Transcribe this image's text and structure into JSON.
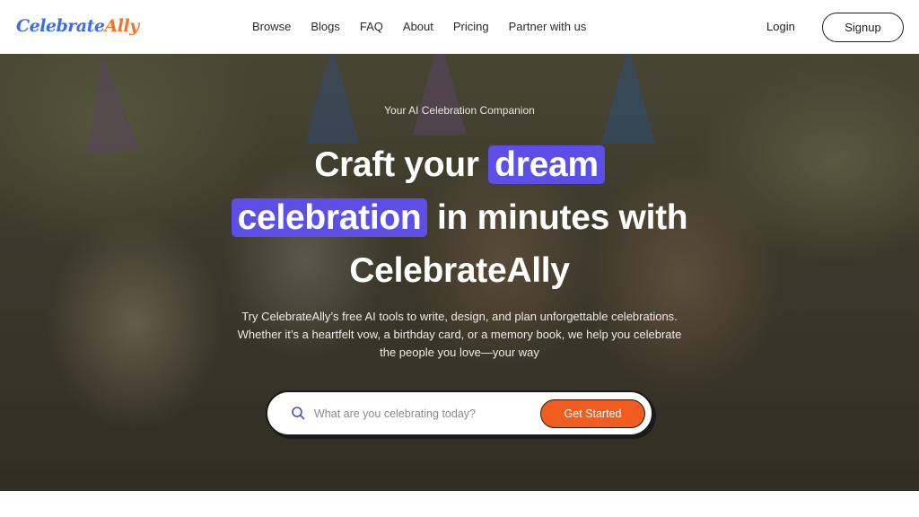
{
  "brand": {
    "name_part1": "Celebrate",
    "name_part2": "Ally",
    "color1": "#3d6ee8",
    "color2": "#f2762a"
  },
  "nav": {
    "links": [
      "Browse",
      "Blogs",
      "FAQ",
      "About",
      "Pricing",
      "Partner with us"
    ],
    "login": "Login",
    "signup": "Signup"
  },
  "hero": {
    "eyebrow": "Your AI Celebration Companion",
    "headline": {
      "part1": "Craft your",
      "highlight1": "dream",
      "highlight2": "celebration",
      "part2": "in minutes with",
      "part3": "CelebrateAlly"
    },
    "highlight_color": "#5b4fe8",
    "subtext": "Try CelebrateAlly’s free AI tools to write, design, and plan unforgettable celebrations. Whether it’s a heartfelt vow, a birthday card, or a memory book, we help you celebrate the people you love—your way",
    "search": {
      "icon": "search-icon",
      "placeholder": "What are you celebrating today?",
      "value": "",
      "button": "Get Started",
      "button_color": "#f05d1e"
    }
  }
}
